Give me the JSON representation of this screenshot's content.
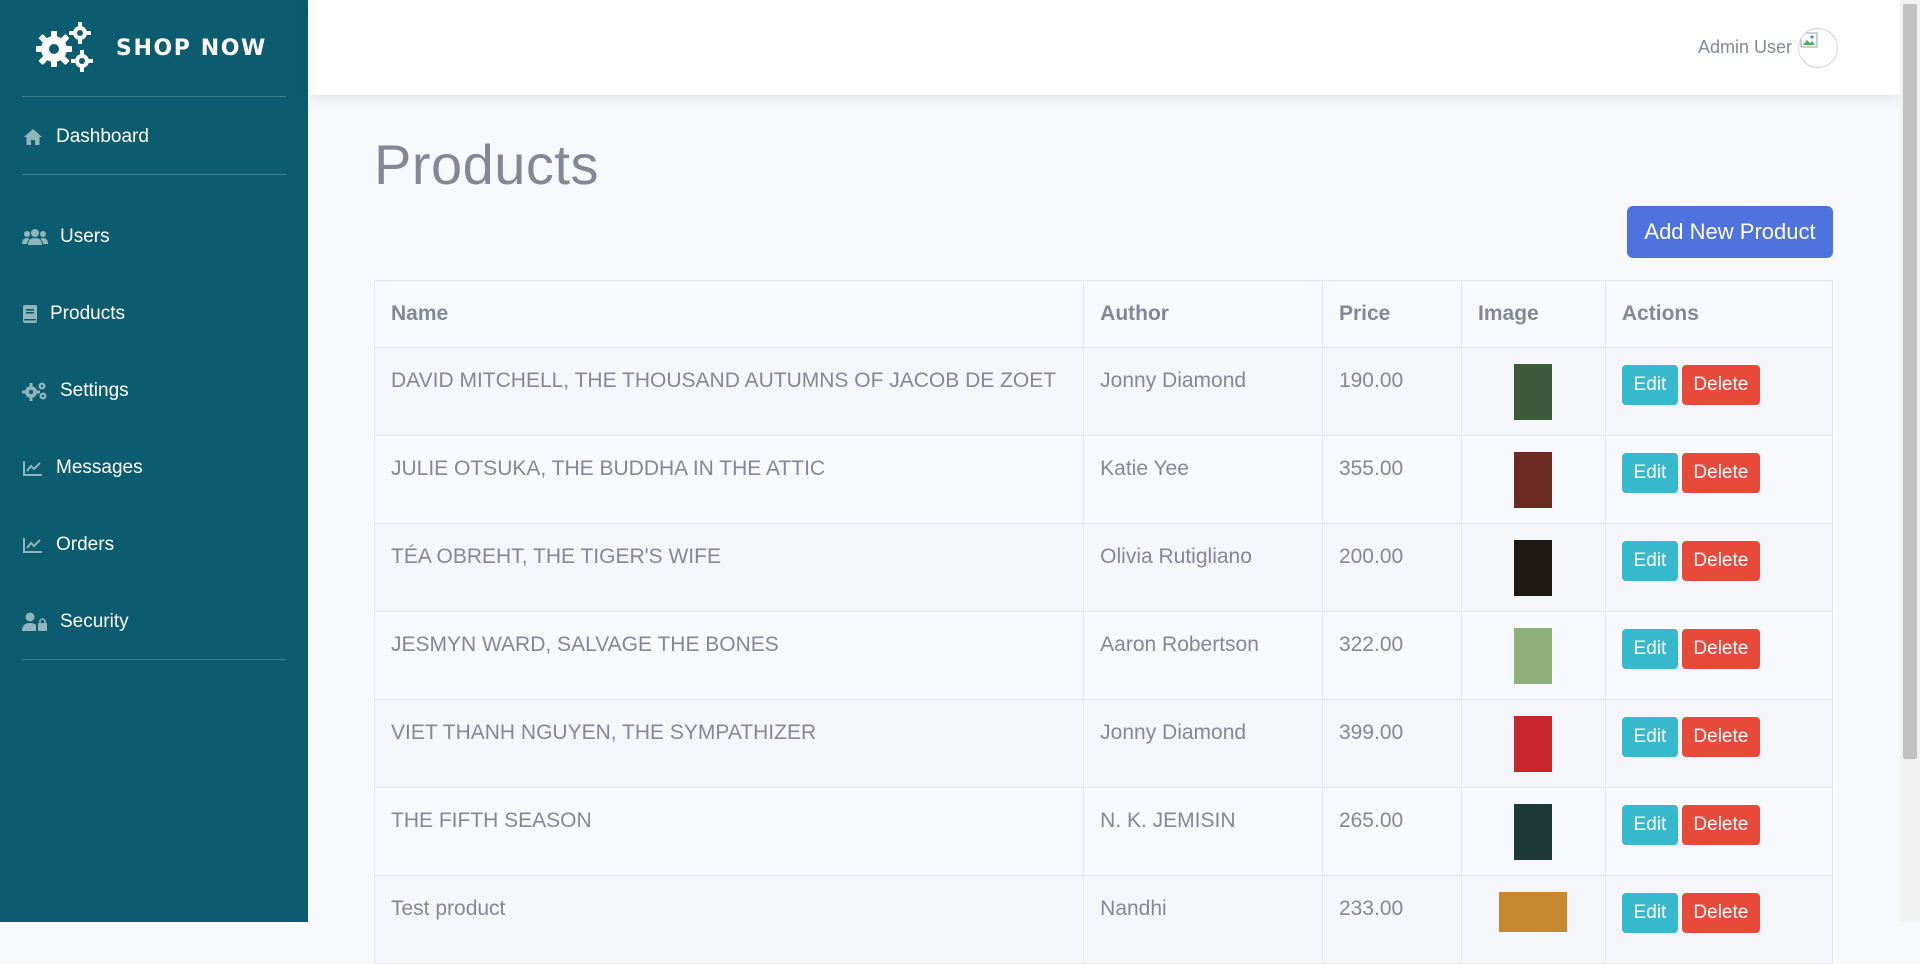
{
  "brand": {
    "name": "SHOP NOW"
  },
  "sidebar": {
    "items": [
      {
        "label": "Dashboard",
        "icon": "home-icon"
      },
      {
        "label": "Users",
        "icon": "users-icon"
      },
      {
        "label": "Products",
        "icon": "book-icon"
      },
      {
        "label": "Settings",
        "icon": "cogs-icon"
      },
      {
        "label": "Messages",
        "icon": "chart-line-icon"
      },
      {
        "label": "Orders",
        "icon": "chart-line-icon"
      },
      {
        "label": "Security",
        "icon": "user-lock-icon"
      }
    ]
  },
  "topbar": {
    "user_name": "Admin User"
  },
  "main": {
    "title": "Products",
    "add_button": "Add New Product",
    "table": {
      "headers": [
        "Name",
        "Author",
        "Price",
        "Image",
        "Actions"
      ],
      "rows": [
        {
          "name": "DAVID MITCHELL, THE THOUSAND AUTUMNS OF JACOB DE ZOET",
          "author": "Jonny Diamond",
          "price": "190.00",
          "thumb_color": "#3d5a3a"
        },
        {
          "name": "JULIE OTSUKA, THE BUDDHA IN THE ATTIC",
          "author": "Katie Yee",
          "price": "355.00",
          "thumb_color": "#6b2a22"
        },
        {
          "name": "TÉA OBREHT, THE TIGER'S WIFE",
          "author": "Olivia Rutigliano",
          "price": "200.00",
          "thumb_color": "#1f1a16"
        },
        {
          "name": "JESMYN WARD, SALVAGE THE BONES",
          "author": "Aaron Robertson",
          "price": "322.00",
          "thumb_color": "#8fb07a"
        },
        {
          "name": "VIET THANH NGUYEN, THE SYMPATHIZER",
          "author": "Jonny Diamond",
          "price": "399.00",
          "thumb_color": "#c8262a"
        },
        {
          "name": "THE FIFTH SEASON",
          "author": "N. K. JEMISIN",
          "price": "265.00",
          "thumb_color": "#1d3a36"
        },
        {
          "name": "Test product",
          "author": "Nandhi",
          "price": "233.00",
          "thumb_color": "#c9872e"
        }
      ],
      "edit_label": "Edit",
      "delete_label": "Delete"
    }
  },
  "colors": {
    "sidebar_bg": "#0a5c6e",
    "primary": "#4e73df",
    "info": "#36b9cc",
    "danger": "#e74a3b",
    "text_muted": "#858796"
  }
}
